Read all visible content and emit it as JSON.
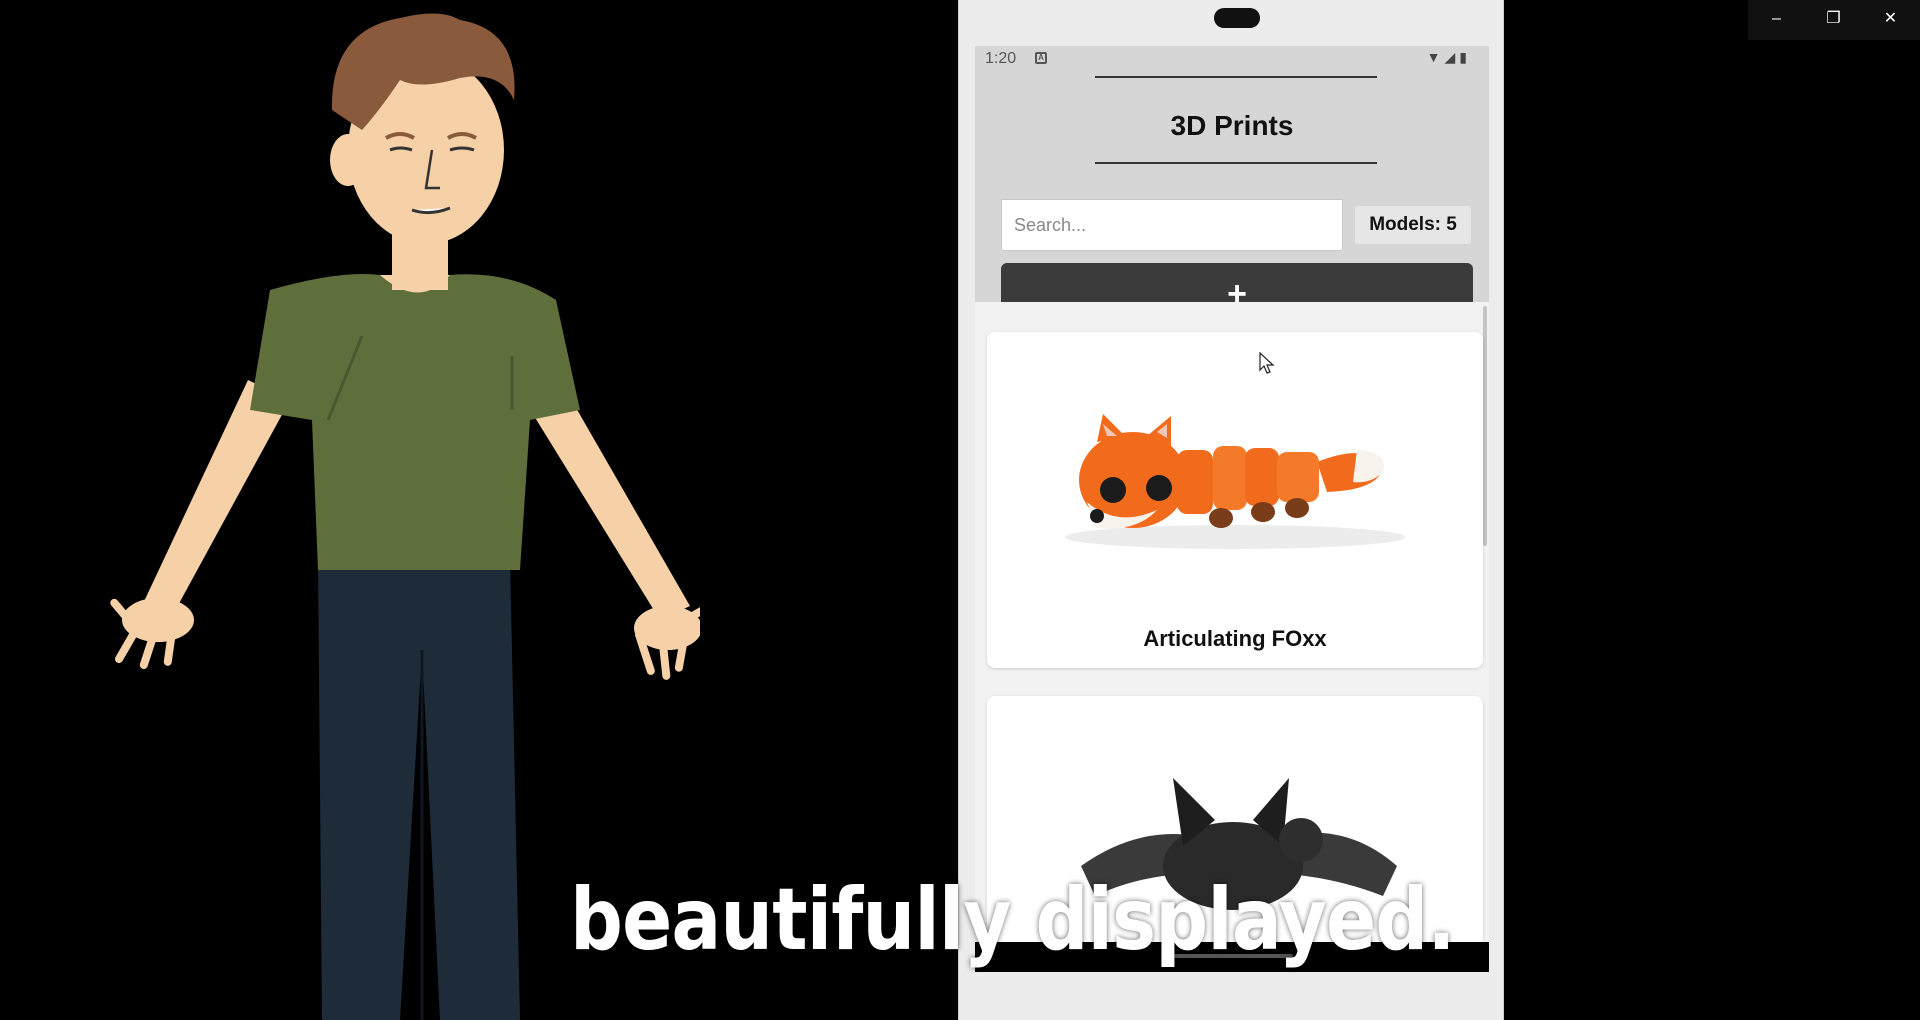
{
  "window_controls": {
    "minimize": "–",
    "maximize": "❐",
    "close": "✕"
  },
  "phone": {
    "status_bar": {
      "time": "1:20",
      "notification_icon": "A",
      "right_icons": "wifi-icon signal-icon battery-icon"
    },
    "app": {
      "title": "3D Prints",
      "search": {
        "placeholder": "Search...",
        "value": ""
      },
      "models_count": "Models: 5",
      "add_button_label": "+",
      "cards": [
        {
          "title": "Articulating FOxx",
          "image": "orange-fox-print"
        },
        {
          "title": "",
          "image": "black-bat-print"
        }
      ]
    }
  },
  "caption": "beautifully displayed.",
  "colors": {
    "header_bg": "#d6d6d6",
    "button_bg": "#3b3b3b",
    "fox_orange": "#f26b1d",
    "shirt_green": "#5f6f3c",
    "jeans_navy": "#1e2c3a"
  }
}
